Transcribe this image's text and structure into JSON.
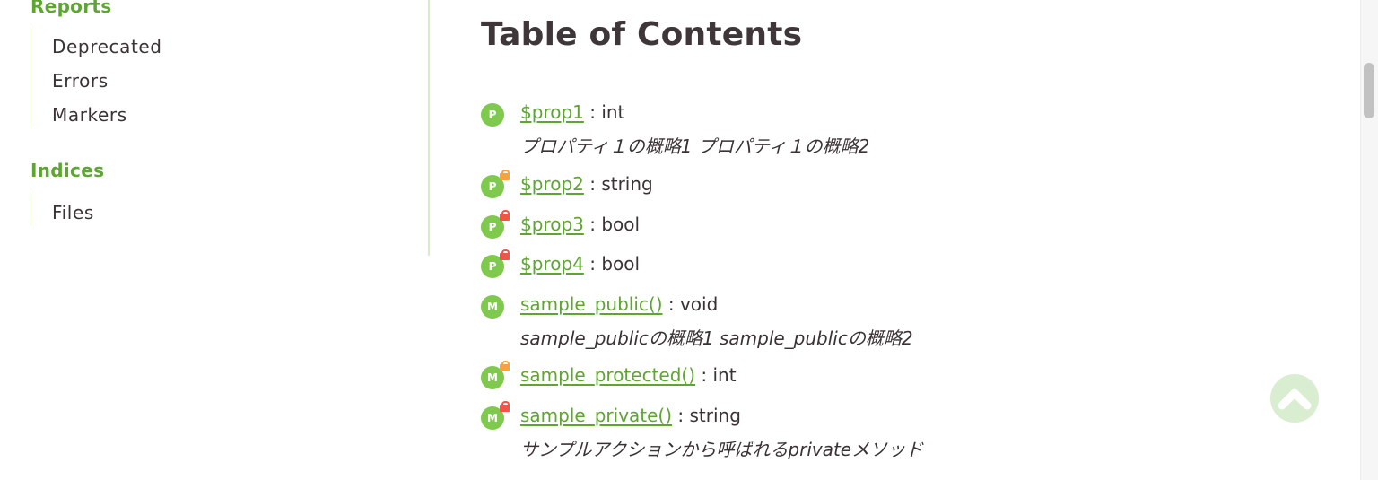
{
  "sidebar": {
    "sections": [
      {
        "title": "Reports",
        "items": [
          "Deprecated",
          "Errors",
          "Markers"
        ]
      },
      {
        "title": "Indices",
        "items": [
          "Files"
        ]
      }
    ]
  },
  "main": {
    "title": "Table of Contents",
    "entries": [
      {
        "badge": "P",
        "name": "$prop1",
        "sep": " : ",
        "type": "int",
        "description": "プロパティ１の概略1 プロパティ１の概略2",
        "visibility": "public"
      },
      {
        "badge": "P",
        "name": "$prop2",
        "sep": " : ",
        "type": "string",
        "description": "",
        "visibility": "protected"
      },
      {
        "badge": "P",
        "name": "$prop3",
        "sep": " : ",
        "type": "bool",
        "description": "",
        "visibility": "private"
      },
      {
        "badge": "P",
        "name": "$prop4",
        "sep": " : ",
        "type": "bool",
        "description": "",
        "visibility": "private"
      },
      {
        "badge": "M",
        "name": "sample_public()",
        "sep": " : ",
        "type": "void",
        "description": "sample_publicの概略1 sample_publicの概略2",
        "visibility": "public"
      },
      {
        "badge": "M",
        "name": "sample_protected()",
        "sep": " : ",
        "type": "int",
        "description": "",
        "visibility": "protected"
      },
      {
        "badge": "M",
        "name": "sample_private()",
        "sep": " : ",
        "type": "string",
        "description": "サンプルアクションから呼ばれるprivateメソッド",
        "visibility": "private"
      }
    ]
  },
  "back_to_top": {
    "icon": "chevron-up-icon"
  },
  "colors": {
    "accent": "#5ea532",
    "badge": "#7fc94f",
    "protected_lock": "#f4a340",
    "private_lock": "#ef5548",
    "back_to_top_bg": "#d9edd0",
    "divider": "#d8ecc9"
  }
}
